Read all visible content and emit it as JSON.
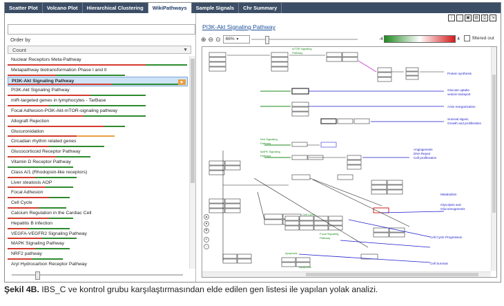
{
  "tabs": [
    {
      "label": "Scatter Plot",
      "active": false
    },
    {
      "label": "Volcano Plot",
      "active": false
    },
    {
      "label": "Hierarchical Clustering",
      "active": false
    },
    {
      "label": "WikiPathways",
      "active": true
    },
    {
      "label": "Sample Signals",
      "active": false
    },
    {
      "label": "Chr Summary",
      "active": false
    }
  ],
  "left_panel": {
    "search_value": "",
    "order_label": "Order by",
    "order_value": "Count",
    "pathways": [
      {
        "label": "Nuclear Receptors Meta-Pathway",
        "bar": [
          [
            "#d33a2c",
            200
          ],
          [
            "#2c8a2c",
            60
          ]
        ]
      },
      {
        "label": "Metapathway biotransformation Phase I and II",
        "bar": [
          [
            "#d33a2c",
            70
          ],
          [
            "#2c8a2c",
            100
          ]
        ]
      },
      {
        "label": "PI3K-Akt Signaling Pathway",
        "bar": [
          [
            "#d33a2c",
            150
          ],
          [
            "#2c8a2c",
            100
          ]
        ],
        "selected": true
      },
      {
        "label": "PI3K-Akt Signaling Pathway",
        "bar": [
          [
            "#d33a2c",
            120
          ],
          [
            "#2c8a2c",
            80
          ]
        ]
      },
      {
        "label": "miR-targeted genes in lymphocytes - TarBase",
        "bar": [
          [
            "#d33a2c",
            60
          ],
          [
            "#2c8a2c",
            140
          ]
        ]
      },
      {
        "label": "Focal Adhesion-PI3K-Akt-mTOR-signaling pathway",
        "bar": [
          [
            "#d33a2c",
            110
          ],
          [
            "#2c8a2c",
            90
          ]
        ]
      },
      {
        "label": "Allograft Rejection",
        "bar": [
          [
            "#d33a2c",
            140
          ],
          [
            "#2c8a2c",
            30
          ]
        ]
      },
      {
        "label": "Glucuronidation",
        "bar": [
          [
            "#d33a2c",
            100
          ],
          [
            "#e8a040",
            55
          ]
        ]
      },
      {
        "label": "Circadian rhythm related genes",
        "bar": [
          [
            "#d33a2c",
            60
          ],
          [
            "#2c8a2c",
            80
          ]
        ]
      },
      {
        "label": "Glucocorticoid Receptor Pathway",
        "bar": [
          [
            "#d33a2c",
            70
          ],
          [
            "#2c8a2c",
            50
          ]
        ]
      },
      {
        "label": "Vitamin D Receptor Pathway",
        "bar": [
          [
            "#2c8a2c",
            95
          ]
        ]
      },
      {
        "label": "Class A/1 (Rhodopsin-like receptors)",
        "bar": [
          [
            "#d33a2c",
            40
          ],
          [
            "#2c8a2c",
            60
          ]
        ]
      },
      {
        "label": "Liver steatosis AOP",
        "bar": [
          [
            "#d33a2c",
            55
          ],
          [
            "#2c8a2c",
            40
          ]
        ]
      },
      {
        "label": "Focal Adhesion",
        "bar": [
          [
            "#d33a2c",
            60
          ],
          [
            "#2c8a2c",
            30
          ]
        ]
      },
      {
        "label": "Cell Cycle",
        "bar": [
          [
            "#d33a2c",
            45
          ],
          [
            "#2c8a2c",
            40
          ]
        ]
      },
      {
        "label": "Calcium Regulation in the Cardiac Cell",
        "bar": [
          [
            "#d33a2c",
            60
          ],
          [
            "#2c8a2c",
            35
          ]
        ]
      },
      {
        "label": "Hepatitis B infection",
        "bar": [
          [
            "#d33a2c",
            30
          ],
          [
            "#2c8a2c",
            60
          ]
        ]
      },
      {
        "label": "VEGFA-VEGFR2 Signaling Pathway",
        "bar": [
          [
            "#d33a2c",
            50
          ],
          [
            "#2c8a2c",
            50
          ]
        ]
      },
      {
        "label": "MAPK Signaling Pathway",
        "bar": [
          [
            "#d33a2c",
            40
          ],
          [
            "#2c8a2c",
            50
          ]
        ]
      },
      {
        "label": "NRF2 pathway",
        "bar": [
          [
            "#d33a2c",
            35
          ],
          [
            "#2c8a2c",
            45
          ]
        ]
      },
      {
        "label": "Aryl Hydrocarbon Receptor Pathway",
        "bar": [
          [
            "#d33a2c",
            40
          ],
          [
            "#2c8a2c",
            50
          ]
        ]
      }
    ]
  },
  "right_panel": {
    "title": "PI3K-Akt Signaling Pathway",
    "zoom": "66%",
    "legend_min": "-4",
    "legend_max": "4",
    "filtered_label": "filtered out",
    "diagram_labels": {
      "protein_synthesis": "Protein synthesis",
      "glucose_uptake": "Glucose uptake\nvesicle transport",
      "actin": "Actin reorganization",
      "survival": "Survival signal,\nGrowth and proliferation",
      "angiogenesis": "Angiogenesis\nDNA Repair\nCell proliferation",
      "metabolism": "Metabolism",
      "glycolysis": "Glycolysis and\nGluconeogenesis",
      "cell_cycle": "Cell Cycle Progression",
      "cell_survival": "Cell Survival",
      "wnt": "Wnt Signaling\nPathway",
      "mapk": "MAPK Signaling\nPathway",
      "mtor": "mTOR signaling\nPathway",
      "cellcycle_small": "Cell Cycle",
      "focal": "Focal Signaling\nPathway",
      "apoptosis1": "Apoptosis",
      "apoptosis2": "Apoptosis"
    }
  },
  "caption": {
    "bold": "Şekil 4B.",
    "text": " IBS_C ve kontrol grubu karşılaştırmasından elde edilen gen listesi ile yapılan yolak analizi."
  }
}
